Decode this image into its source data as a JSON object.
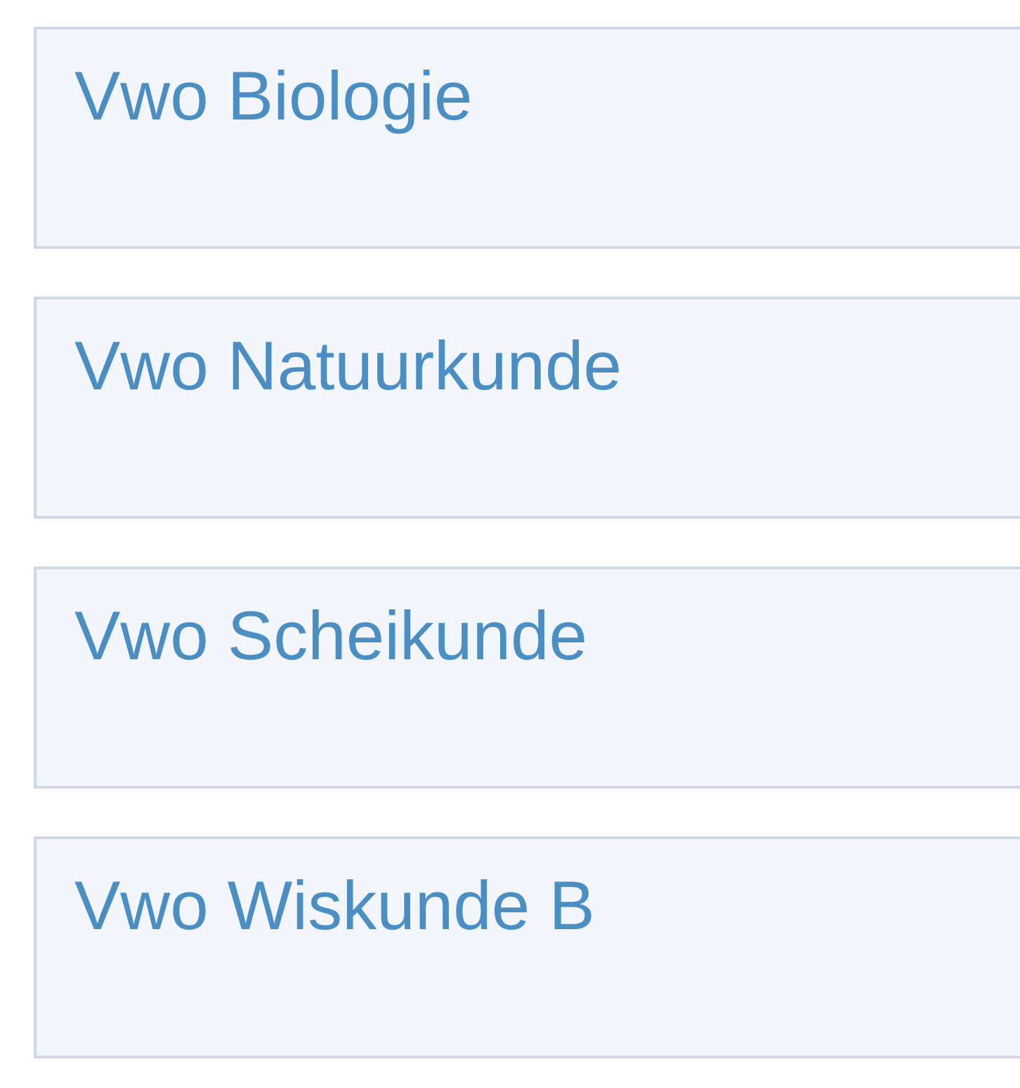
{
  "courses": [
    {
      "title": "Vwo Biologie"
    },
    {
      "title": "Vwo Natuurkunde"
    },
    {
      "title": "Vwo Scheikunde"
    },
    {
      "title": "Vwo Wiskunde B"
    }
  ]
}
